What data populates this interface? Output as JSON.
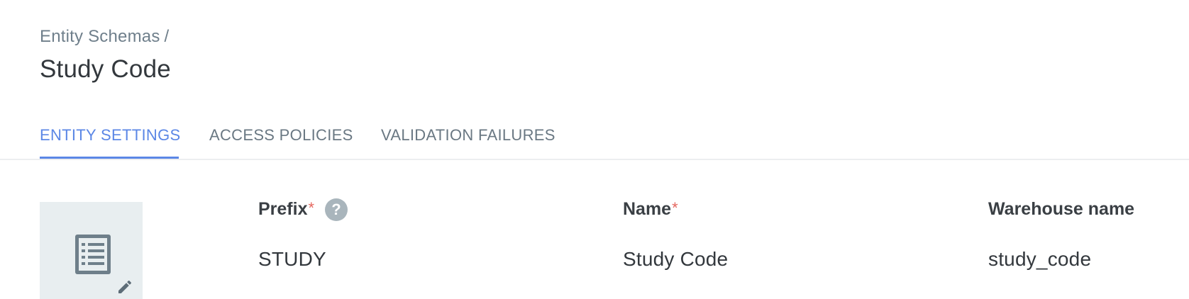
{
  "breadcrumb": {
    "parent": "Entity Schemas",
    "separator": "/"
  },
  "page_title": "Study Code",
  "tabs": [
    {
      "label": "ENTITY SETTINGS",
      "active": true
    },
    {
      "label": "ACCESS POLICIES",
      "active": false
    },
    {
      "label": "VALIDATION FAILURES",
      "active": false
    }
  ],
  "entity_icon": {
    "icon": "list-icon",
    "edit_icon": "pencil-icon"
  },
  "fields": {
    "prefix": {
      "label": "Prefix",
      "required_mark": "*",
      "help": "?",
      "value": "STUDY"
    },
    "name": {
      "label": "Name",
      "required_mark": "*",
      "value": "Study Code"
    },
    "warehouse_name": {
      "label": "Warehouse name",
      "value": "study_code"
    }
  },
  "colors": {
    "accent": "#5b87e6",
    "required": "#e5675f",
    "icon_box_bg": "#e8eef0",
    "icon": "#6e7f8a"
  }
}
